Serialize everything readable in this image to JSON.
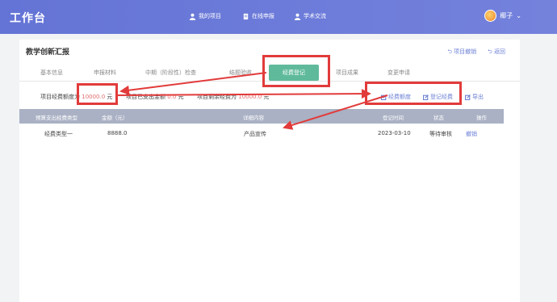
{
  "header": {
    "brand": "工作台",
    "nav": [
      {
        "label": "我的项目"
      },
      {
        "label": "在线申报"
      },
      {
        "label": "学术交流"
      }
    ],
    "user_name": "椰子",
    "user_chevron": "⌄"
  },
  "page": {
    "title": "教学创新汇报",
    "actions": {
      "withdraw": "⮌ 项目撤销",
      "back": "⮌ 返回"
    }
  },
  "tabs": [
    "基本信息",
    "申报材料",
    "中期（阶段性）检查",
    "结题验收",
    "经费登记",
    "项目成果",
    "变更申请"
  ],
  "active_tab": "经费登记",
  "budget": {
    "total_label": "项目经费额度为",
    "total_value": "10000.0",
    "total_unit": "元",
    "spent_label": "项目已支出金额",
    "spent_value": "0.0",
    "spent_unit": "元",
    "remaining_label": "项目剩余经费为",
    "remaining_value": "10000.0",
    "remaining_unit": "元"
  },
  "operations": {
    "quota": "经费额度",
    "register": "登记经费",
    "export": "导出"
  },
  "table": {
    "columns": [
      "预算支出经费类型",
      "金额（元）",
      "详细内容",
      "登记时间",
      "状态",
      "操作"
    ],
    "rows": [
      {
        "type": "经费类型一",
        "amount": "8888.0",
        "detail": "产品宣传",
        "date": "2023-03-10",
        "status": "等待审核",
        "action": "撤销"
      }
    ]
  },
  "colors": {
    "header": "#6a78d8",
    "accent": "#6b7fd4",
    "tab_active": "#5fba9b",
    "highlight_red": "#e23b3b",
    "value_red": "#e36b6b"
  }
}
